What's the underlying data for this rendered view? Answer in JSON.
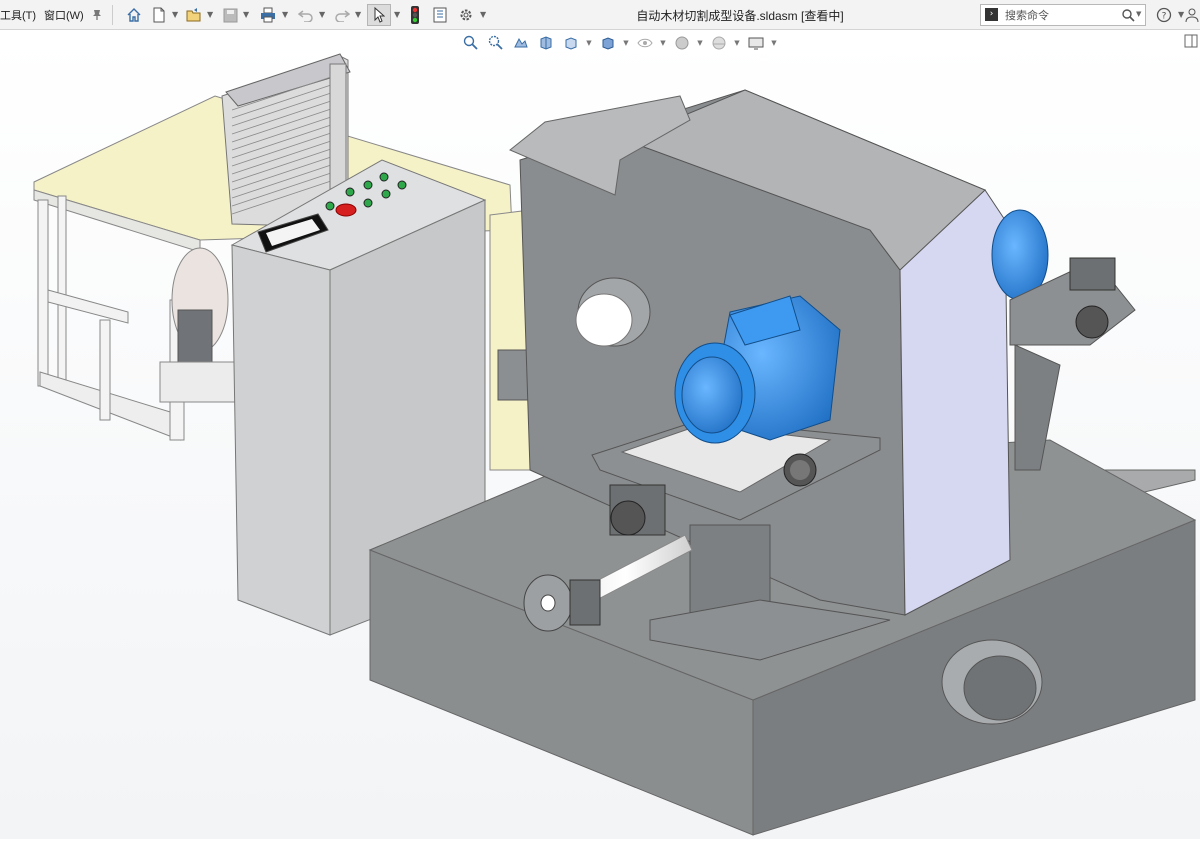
{
  "menu": {
    "tools": "工具(T)",
    "window": "窗口(W)"
  },
  "document": {
    "title": "自动木材切割成型设备.sldasm [查看中]"
  },
  "search": {
    "placeholder": "搜索命令"
  },
  "icons": {
    "toolbar": [
      "pin-icon",
      "home-icon",
      "new-doc-icon",
      "open-icon",
      "save-icon",
      "print-icon",
      "undo-icon",
      "redo-icon",
      "select-icon",
      "traffic-light-icon",
      "file-properties-icon",
      "options-icon"
    ],
    "view": [
      "zoom-to-fit-icon",
      "zoom-area-icon",
      "previous-view-icon",
      "section-view-icon",
      "view-orientation-icon",
      "display-style-icon",
      "hide-show-icon",
      "appearance-icon",
      "scene-icon",
      "display-settings-icon"
    ],
    "right": [
      "command-prompt-icon",
      "search-icon",
      "help-icon",
      "account-icon"
    ]
  },
  "colors": {
    "motor_blue": "#2f8ee6",
    "machine_gray": "#8f9293",
    "panel_gray": "#c9cbcc",
    "table_yellow": "#f6f2c8",
    "stop_red": "#d61f1f",
    "button_green": "#2ea84b"
  }
}
